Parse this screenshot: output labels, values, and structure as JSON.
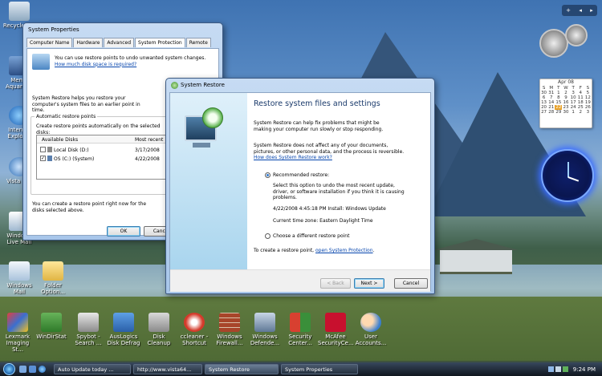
{
  "desktop": {
    "icons": [
      {
        "label": "Recycle Bin"
      },
      {
        "label": "Memo Aquarium"
      },
      {
        "label": "Internet Explorer"
      },
      {
        "label": "Vista Res"
      },
      {
        "label": "Windows Live Mail"
      },
      {
        "label": "Windows Mail"
      },
      {
        "label": "Folder Option..."
      },
      {
        "label": "Lexmark Imaging St..."
      },
      {
        "label": "WinDirStat"
      },
      {
        "label": "Spybot - Search ..."
      },
      {
        "label": "AusLogics Disk Defrag"
      },
      {
        "label": "Disk Cleanup"
      },
      {
        "label": "ccleaner - Shortcut"
      },
      {
        "label": "Windows Firewall..."
      },
      {
        "label": "Windows Defende..."
      },
      {
        "label": "Security Center..."
      },
      {
        "label": "McAfee SecurityCe..."
      },
      {
        "label": "User Accounts..."
      }
    ]
  },
  "system_properties": {
    "title": "System Properties",
    "tabs": [
      "Computer Name",
      "Hardware",
      "Advanced",
      "System Protection",
      "Remote"
    ],
    "active_tab": "System Protection",
    "intro_text": "You can use restore points to undo unwanted system changes.",
    "intro_link": "How much disk space is required?",
    "restore_text": "System Restore helps you restore your computer's system files to an earlier point in time.",
    "group_label": "Automatic restore points",
    "group_text": "Create restore points automatically on the selected disks:",
    "col_disks": "Available Disks",
    "col_recent": "Most recent",
    "disks": [
      {
        "name": "Local Disk (D:)",
        "date": "3/17/2008",
        "checked": false
      },
      {
        "name": "OS (C:) (System)",
        "date": "4/22/2008",
        "checked": true
      }
    ],
    "create_text": "You can create a restore point right now for the disks selected above.",
    "ok": "OK",
    "cancel": "Cancel"
  },
  "system_restore": {
    "title": "System Restore",
    "heading": "Restore system files and settings",
    "para1": "System Restore can help fix problems that might be making your computer run slowly or stop responding.",
    "para2": "System Restore does not affect any of your documents, pictures, or other personal data, and the process is reversible.",
    "para2_link": "How does System Restore work?",
    "option1": "Recommended restore:",
    "option1_desc": "Select this option to undo the most recent update, driver, or software installation if you think it is causing problems.",
    "restore_point": "4/22/2008 4:45:18 PM   Install: Windows Update",
    "time_zone": "Current time zone: Eastern Daylight Time",
    "option2": "Choose a different restore point",
    "create_prefix": "To create a restore point,",
    "create_link": "open System Protection",
    "create_suffix": ".",
    "back": "< Back",
    "next": "Next >",
    "cancel": "Cancel"
  },
  "calendar": {
    "month": "Apr 08",
    "headers": [
      "S",
      "M",
      "T",
      "W",
      "T",
      "F",
      "S"
    ],
    "rows": [
      [
        "30",
        "31",
        "1",
        "2",
        "3",
        "4",
        "5"
      ],
      [
        "6",
        "7",
        "8",
        "9",
        "10",
        "11",
        "12"
      ],
      [
        "13",
        "14",
        "15",
        "16",
        "17",
        "18",
        "19"
      ],
      [
        "20",
        "21",
        "22",
        "23",
        "24",
        "25",
        "26"
      ],
      [
        "27",
        "28",
        "29",
        "30",
        "1",
        "2",
        "3"
      ]
    ],
    "today": "22"
  },
  "taskbar": {
    "buttons": [
      {
        "label": "Auto Update today ..."
      },
      {
        "label": "http://www.vista64..."
      },
      {
        "label": "System Restore"
      },
      {
        "label": "System Properties"
      }
    ],
    "clock": "9:24 PM"
  },
  "colors": {
    "link": "#0645ad",
    "window_frame": "#a8c6ea"
  }
}
